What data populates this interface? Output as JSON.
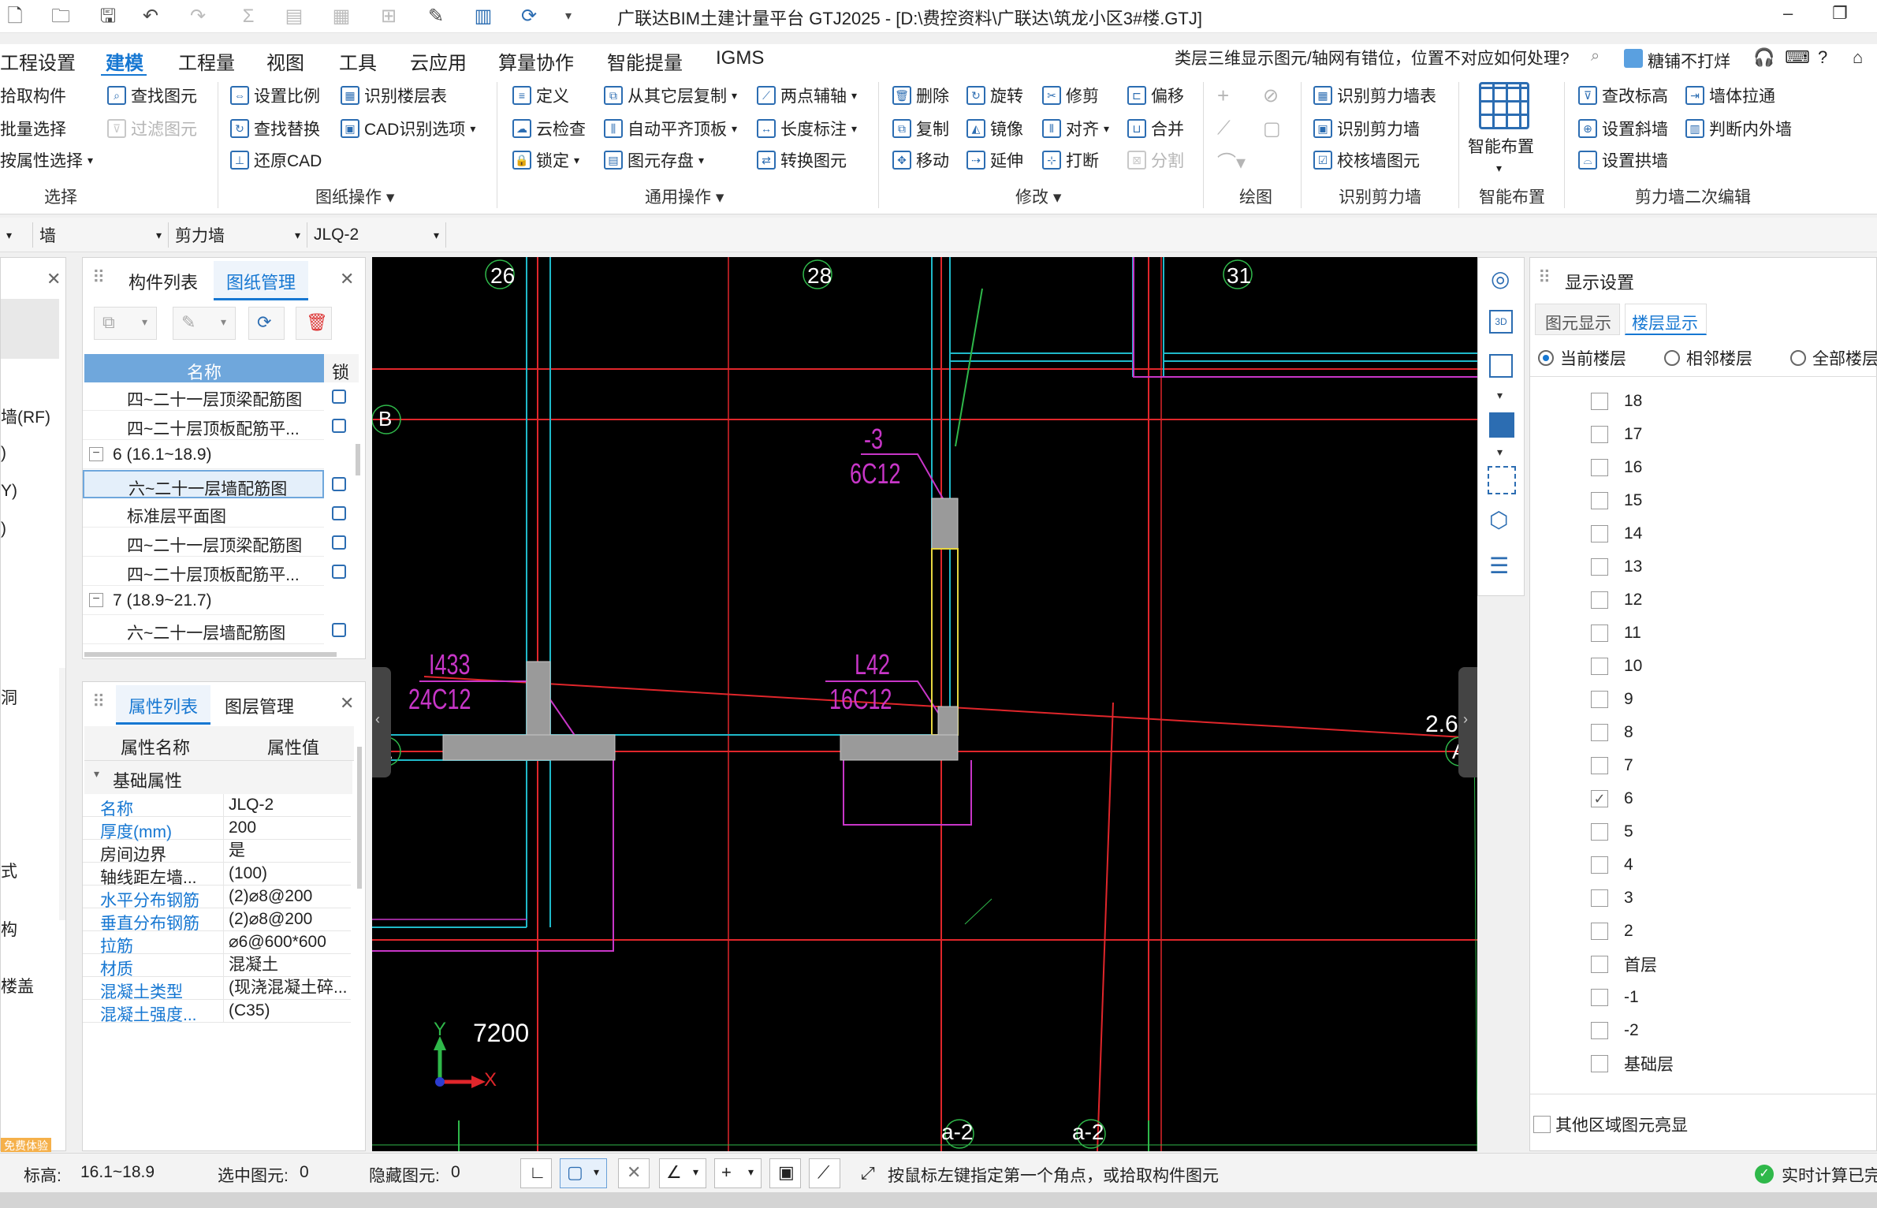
{
  "titlebar": {
    "title": "广联达BIM土建计量平台 GTJ2025 - [D:\\费控资料\\广联达\\筑龙小区3#楼.GTJ]",
    "min": "–",
    "restore": "❐"
  },
  "menu": {
    "items": [
      "工程设置",
      "建模",
      "工程量",
      "视图",
      "工具",
      "云应用",
      "算量协作",
      "智能提量",
      "IGMS"
    ],
    "active": "建模",
    "help_question": "类层三维显示图元/轴网有错位，位置不对应如何处理?",
    "user": "糖铺不打烊"
  },
  "ribbon": {
    "select": {
      "pick": "拾取构件",
      "batch": "批量选择",
      "by_attr": "按属性选择",
      "find": "查找图元",
      "filter": "过滤图元",
      "group": "选择"
    },
    "drawing_ops": {
      "set_scale": "设置比例",
      "find_replace": "查找替换",
      "restore_cad": "还原CAD",
      "identify_floors": "识别楼层表",
      "cad_options": "CAD识别选项",
      "group": "图纸操作"
    },
    "common_ops": {
      "define": "定义",
      "cloud_check": "云检查",
      "lock": "锁定",
      "copy_from_floor": "从其它层复制",
      "auto_align": "自动平齐顶板",
      "save_elements": "图元存盘",
      "two_point_axis": "两点辅轴",
      "length_dim": "长度标注",
      "convert": "转换图元",
      "group": "通用操作"
    },
    "modify": {
      "delete": "删除",
      "copy": "复制",
      "move": "移动",
      "rotate": "旋转",
      "mirror": "镜像",
      "extend": "延伸",
      "trim": "修剪",
      "align": "对齐",
      "break": "打断",
      "offset": "偏移",
      "merge": "合并",
      "split": "分割",
      "group": "修改"
    },
    "draw": {
      "group": "绘图"
    },
    "identify_wall": {
      "identify_table": "识别剪力墙表",
      "identify_wall": "识别剪力墙",
      "check_wall": "校核墙图元",
      "group": "识别剪力墙"
    },
    "smart": {
      "label": "智能布置",
      "group": "智能布置"
    },
    "wall_edit": {
      "change_elev": "查改标高",
      "set_slope": "设置斜墙",
      "set_arch": "设置拱墙",
      "wall_stretch": "墙体拉通",
      "judge_side": "判断内外墙",
      "group": "剪力墙二次编辑"
    }
  },
  "selectors": {
    "type": "墙",
    "subtype": "剪力墙",
    "name": "JLQ-2"
  },
  "left_strip": {
    "items": [
      "墙(RF)",
      ")",
      "Y)",
      ")",
      "洞",
      "式",
      "构",
      "楼盖"
    ],
    "bottom_tag": "免费体验"
  },
  "drawing_panel": {
    "tabs": [
      "构件列表",
      "图纸管理"
    ],
    "active_tab": "图纸管理",
    "col_name": "名称",
    "col_lock": "锁",
    "rows": [
      {
        "text": "四~二十一层顶梁配筋图",
        "indent": 2
      },
      {
        "text": "四~二十层顶板配筋平...",
        "indent": 2
      },
      {
        "text": "6 (16.1~18.9)",
        "indent": 0,
        "group": true
      },
      {
        "text": "六~二十一层墙配筋图",
        "indent": 2,
        "selected": true
      },
      {
        "text": "标准层平面图",
        "indent": 2
      },
      {
        "text": "四~二十一层顶梁配筋图",
        "indent": 2
      },
      {
        "text": "四~二十层顶板配筋平...",
        "indent": 2
      },
      {
        "text": "7 (18.9~21.7)",
        "indent": 0,
        "group": true
      },
      {
        "text": "六~二十一层墙配筋图",
        "indent": 2
      }
    ]
  },
  "property_panel": {
    "tabs": [
      "属性列表",
      "图层管理"
    ],
    "active_tab": "属性列表",
    "col_name": "属性名称",
    "col_value": "属性值",
    "section": "基础属性",
    "rows": [
      {
        "name": "名称",
        "value": "JLQ-2",
        "blue": true
      },
      {
        "name": "厚度(mm)",
        "value": "200",
        "blue": true
      },
      {
        "name": "房间边界",
        "value": "是",
        "blue": false
      },
      {
        "name": "轴线距左墙...",
        "value": "(100)",
        "blue": false
      },
      {
        "name": "水平分布钢筋",
        "value": "(2)⌀8@200",
        "blue": true
      },
      {
        "name": "垂直分布钢筋",
        "value": "(2)⌀8@200",
        "blue": true
      },
      {
        "name": "拉筋",
        "value": "⌀6@600*600",
        "blue": true
      },
      {
        "name": "材质",
        "value": "混凝土",
        "blue": true
      },
      {
        "name": "混凝土类型",
        "value": "(现浇混凝土碎...",
        "blue": true
      },
      {
        "name": "混凝土强度...",
        "value": "(C35)",
        "blue": true
      }
    ]
  },
  "canvas": {
    "axis_top": [
      "26",
      "28",
      "31"
    ],
    "axis_left": [
      "B",
      "A"
    ],
    "axis_right": "A",
    "axis_bottom": [
      "a-2",
      "a-2"
    ],
    "label_left_1": "I433",
    "label_left_2": "24C12",
    "label_mid_1": "L42",
    "label_mid_2": "16C12",
    "label_top_1": "-3",
    "label_top_2": "6C12",
    "value_right": "2.6",
    "dim_text": "7200",
    "ucs_y": "Y",
    "ucs_x": "X",
    "colors": {
      "red": "#e0262b",
      "cyan": "#1fb9c9",
      "magenta": "#c836c8",
      "grey": "#9a9a9a",
      "green": "#2fb84a"
    }
  },
  "display_panel": {
    "title": "显示设置",
    "tabs": [
      "图元显示",
      "楼层显示"
    ],
    "active_tab": "楼层显示",
    "radios": [
      "当前楼层",
      "相邻楼层",
      "全部楼层"
    ],
    "radio_selected": "当前楼层",
    "floors": [
      "18",
      "17",
      "16",
      "15",
      "14",
      "13",
      "12",
      "11",
      "10",
      "9",
      "8",
      "7",
      "6",
      "5",
      "4",
      "3",
      "2",
      "首层",
      "-1",
      "-2",
      "基础层"
    ],
    "checked_floor": "6",
    "other_region": "其他区域图元亮显"
  },
  "statusbar": {
    "elev_label": "标高:",
    "elev_value": "16.1~18.9",
    "selected_label": "选中图元:",
    "selected_value": "0",
    "hidden_label": "隐藏图元:",
    "hidden_value": "0",
    "hint": "按鼠标左键指定第一个角点，或拾取构件图元",
    "realtime": "实时计算已完"
  }
}
